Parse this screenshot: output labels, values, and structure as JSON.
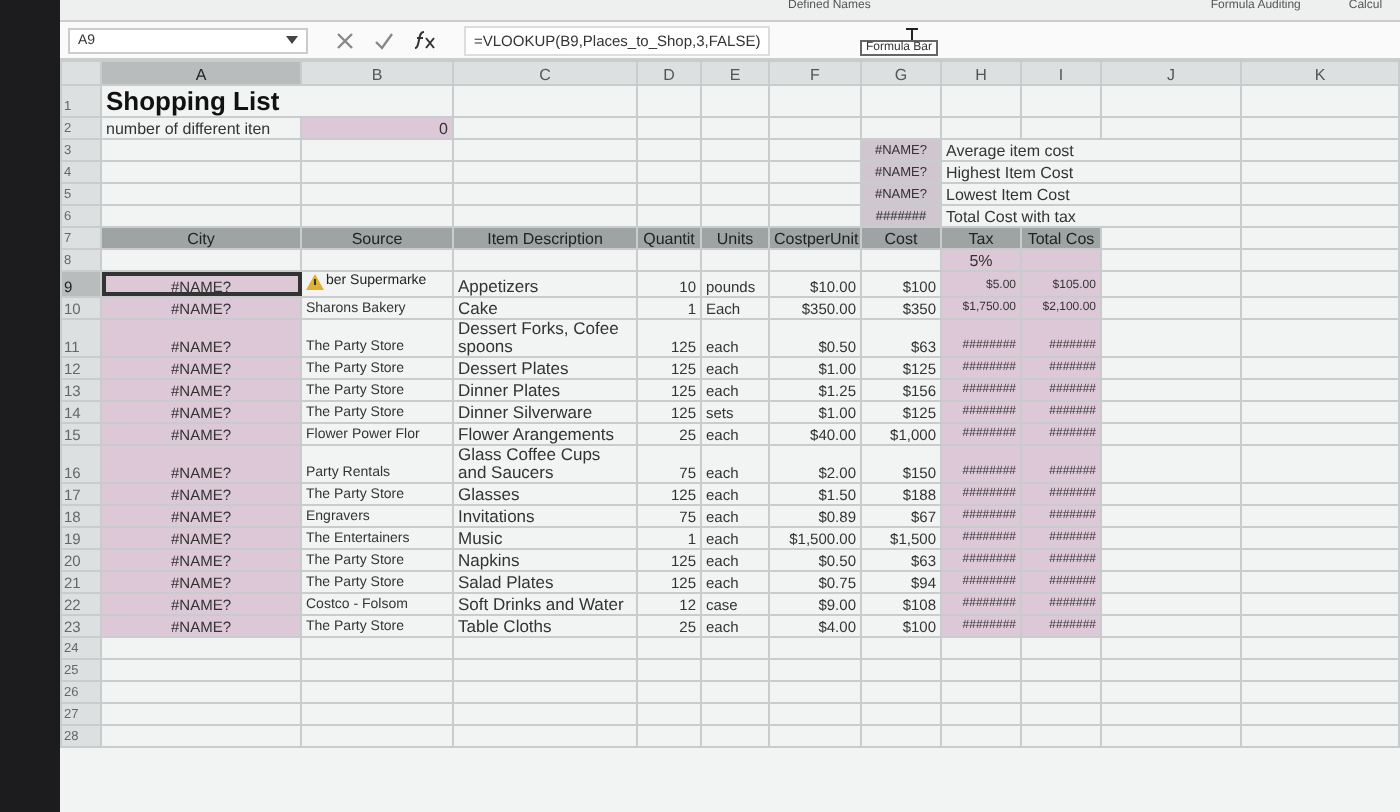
{
  "ribbon_groups": [
    "Defined Names",
    "Formula Auditing",
    "Calcul"
  ],
  "formula_bar": {
    "name_box": "A9",
    "formula": "=VLOOKUP(B9,Places_to_Shop,3,FALSE)",
    "tooltip": "Formula Bar"
  },
  "column_headers": [
    {
      "label": "A",
      "selected": true
    },
    {
      "label": "B",
      "selected": false
    },
    {
      "label": "C",
      "selected": false
    },
    {
      "label": "D",
      "selected": false
    },
    {
      "label": "E",
      "selected": false
    },
    {
      "label": "F",
      "selected": false
    },
    {
      "label": "G",
      "selected": false
    },
    {
      "label": "H",
      "selected": false
    },
    {
      "label": "I",
      "selected": false
    },
    {
      "label": "J",
      "selected": false
    },
    {
      "label": "K",
      "selected": false
    }
  ],
  "row_numbers": [
    "1",
    "2",
    "3",
    "4",
    "5",
    "6",
    "7",
    "8",
    "9",
    "10",
    "11",
    "12",
    "13",
    "14",
    "15",
    "16",
    "17",
    "18",
    "19",
    "20",
    "21",
    "22",
    "23",
    "24",
    "25",
    "26",
    "27",
    "28"
  ],
  "title": "Shopping List",
  "count": {
    "label": "number of different iten",
    "value": "0"
  },
  "summary": [
    {
      "value": "#NAME?",
      "label": "Average item cost"
    },
    {
      "value": "#NAME?",
      "label": "Highest Item Cost"
    },
    {
      "value": "#NAME?",
      "label": "Lowest Item Cost"
    },
    {
      "value": "#######",
      "label": "Total Cost with tax"
    }
  ],
  "table_columns": [
    "City",
    "Source",
    "Item Description",
    "Quantit",
    "Units",
    "CostperUnit",
    "Cost",
    "Tax",
    "Total Cos"
  ],
  "tax_rate": "5%",
  "items": [
    {
      "city": "#NAME?",
      "source": "ber Supermarke",
      "description": "Appetizers",
      "quantity": "10",
      "units": "pounds",
      "cost_per_unit": "$10.00",
      "cost": "$100",
      "tax": "$5.00",
      "total": "$105.00",
      "selected": true,
      "warning": true
    },
    {
      "city": "#NAME?",
      "source": "Sharons Bakery",
      "description": "Cake",
      "quantity": "1",
      "units": "Each",
      "cost_per_unit": "$350.00",
      "cost": "$350",
      "tax": "$1,750.00",
      "total": "$2,100.00",
      "selected": false,
      "warning": false
    },
    {
      "city": "#NAME?",
      "source": "The Party Store",
      "description": "Dessert Forks, Cofee spoons",
      "quantity": "125",
      "units": "each",
      "cost_per_unit": "$0.50",
      "cost": "$63",
      "tax": "########",
      "total": "#######",
      "selected": false,
      "warning": false
    },
    {
      "city": "#NAME?",
      "source": "The Party Store",
      "description": "Dessert Plates",
      "quantity": "125",
      "units": "each",
      "cost_per_unit": "$1.00",
      "cost": "$125",
      "tax": "########",
      "total": "#######",
      "selected": false,
      "warning": false
    },
    {
      "city": "#NAME?",
      "source": "The Party Store",
      "description": "Dinner Plates",
      "quantity": "125",
      "units": "each",
      "cost_per_unit": "$1.25",
      "cost": "$156",
      "tax": "########",
      "total": "#######",
      "selected": false,
      "warning": false
    },
    {
      "city": "#NAME?",
      "source": "The Party Store",
      "description": "Dinner Silverware",
      "quantity": "125",
      "units": "sets",
      "cost_per_unit": "$1.00",
      "cost": "$125",
      "tax": "########",
      "total": "#######",
      "selected": false,
      "warning": false
    },
    {
      "city": "#NAME?",
      "source": "Flower Power Flor",
      "description": "Flower Arangements",
      "quantity": "25",
      "units": "each",
      "cost_per_unit": "$40.00",
      "cost": "$1,000",
      "tax": "########",
      "total": "#######",
      "selected": false,
      "warning": false
    },
    {
      "city": "#NAME?",
      "source": "Party Rentals",
      "description": "Glass Coffee Cups and Saucers",
      "quantity": "75",
      "units": "each",
      "cost_per_unit": "$2.00",
      "cost": "$150",
      "tax": "########",
      "total": "#######",
      "selected": false,
      "warning": false
    },
    {
      "city": "#NAME?",
      "source": "The Party Store",
      "description": "Glasses",
      "quantity": "125",
      "units": "each",
      "cost_per_unit": "$1.50",
      "cost": "$188",
      "tax": "########",
      "total": "#######",
      "selected": false,
      "warning": false
    },
    {
      "city": "#NAME?",
      "source": "Engravers",
      "description": "Invitations",
      "quantity": "75",
      "units": "each",
      "cost_per_unit": "$0.89",
      "cost": "$67",
      "tax": "########",
      "total": "#######",
      "selected": false,
      "warning": false
    },
    {
      "city": "#NAME?",
      "source": "The Entertainers",
      "description": "Music",
      "quantity": "1",
      "units": "each",
      "cost_per_unit": "$1,500.00",
      "cost": "$1,500",
      "tax": "########",
      "total": "#######",
      "selected": false,
      "warning": false
    },
    {
      "city": "#NAME?",
      "source": "The Party Store",
      "description": "Napkins",
      "quantity": "125",
      "units": "each",
      "cost_per_unit": "$0.50",
      "cost": "$63",
      "tax": "########",
      "total": "#######",
      "selected": false,
      "warning": false
    },
    {
      "city": "#NAME?",
      "source": "The Party Store",
      "description": "Salad Plates",
      "quantity": "125",
      "units": "each",
      "cost_per_unit": "$0.75",
      "cost": "$94",
      "tax": "########",
      "total": "#######",
      "selected": false,
      "warning": false
    },
    {
      "city": "#NAME?",
      "source": "Costco - Folsom",
      "description": "Soft Drinks and Water",
      "quantity": "12",
      "units": "case",
      "cost_per_unit": "$9.00",
      "cost": "$108",
      "tax": "########",
      "total": "#######",
      "selected": false,
      "warning": false
    },
    {
      "city": "#NAME?",
      "source": "The Party Store",
      "description": "Table Cloths",
      "quantity": "25",
      "units": "each",
      "cost_per_unit": "$4.00",
      "cost": "$100",
      "tax": "########",
      "total": "#######",
      "selected": false,
      "warning": false
    }
  ]
}
